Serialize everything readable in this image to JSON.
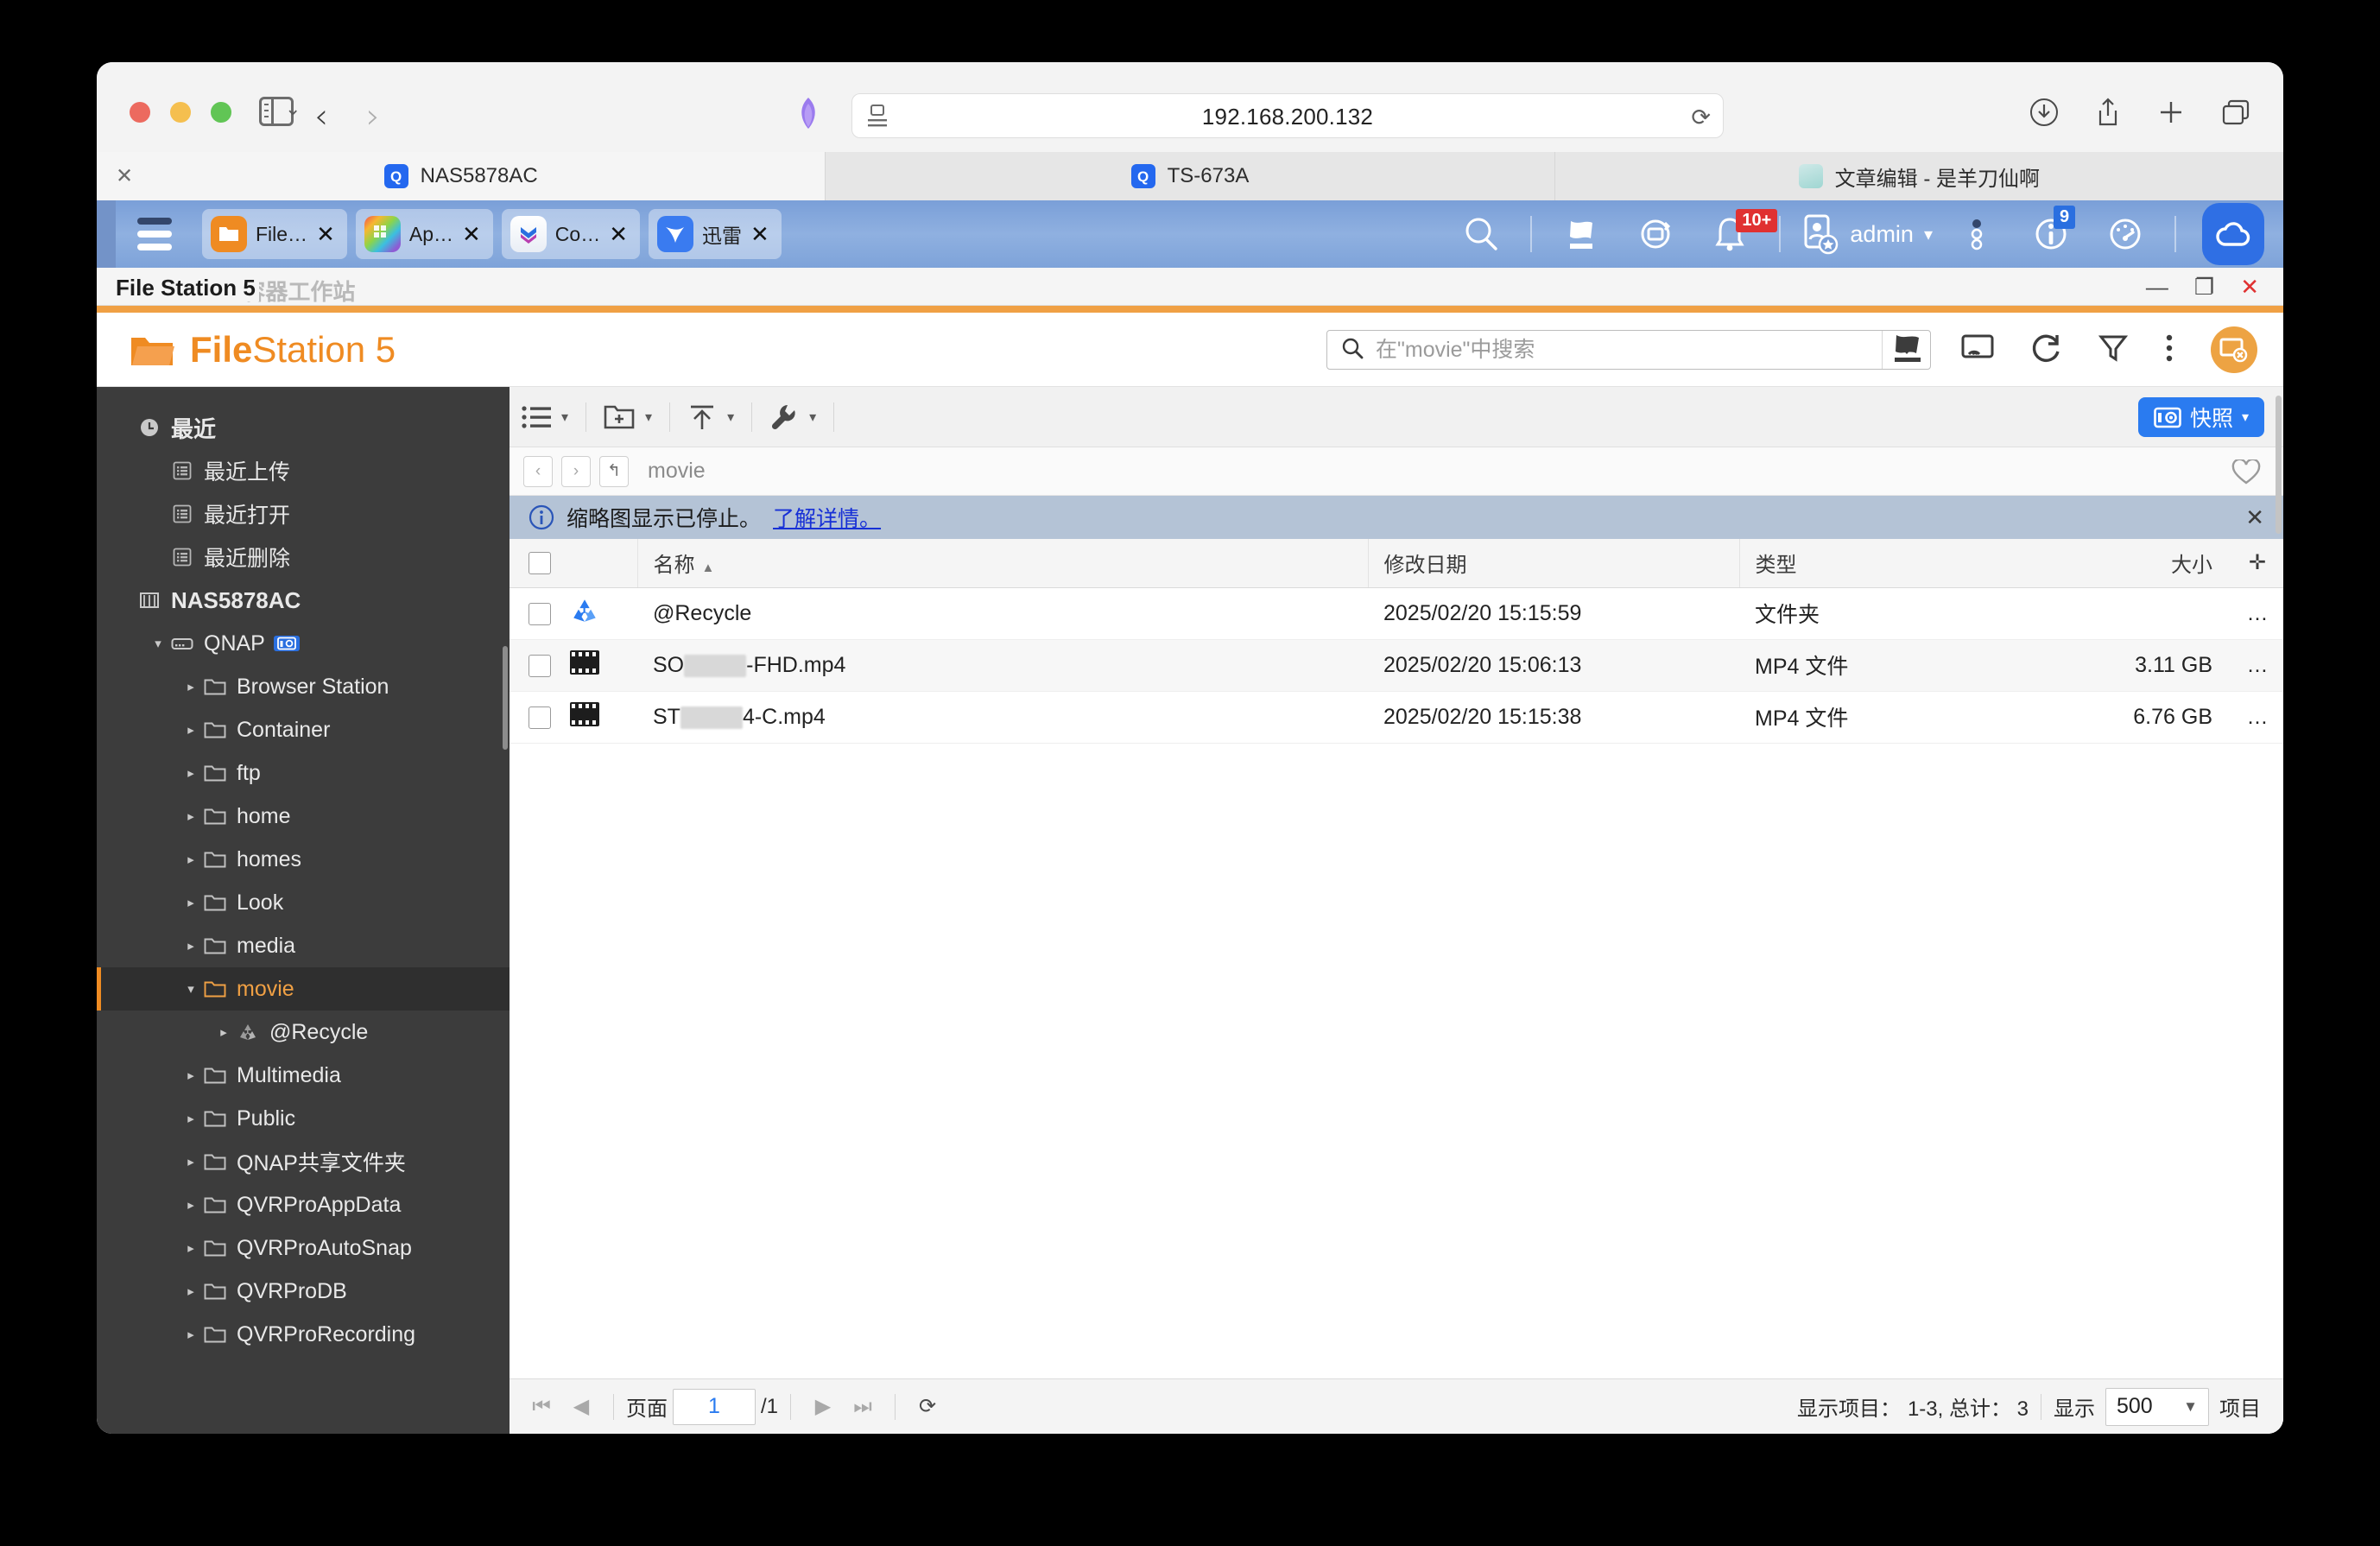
{
  "browser": {
    "url": "192.168.200.132",
    "tabs": [
      {
        "label": "NAS5878AC",
        "icon": "qnap-favicon",
        "active": true
      },
      {
        "label": "TS-673A",
        "icon": "qnap-favicon",
        "active": false
      },
      {
        "label": "文章编辑 - 是羊刀仙啊",
        "icon": "anime-favicon",
        "active": false
      }
    ],
    "toolbar": {
      "close_tab": "✕",
      "back": "‹",
      "forward": "›",
      "reload": "⟳"
    }
  },
  "taskbar": {
    "apps": [
      {
        "label": "File…",
        "icon": "filestation-icon",
        "close": "✕"
      },
      {
        "label": "Ap…",
        "icon": "appcenter-icon",
        "close": "✕"
      },
      {
        "label": "Co…",
        "icon": "container-icon",
        "close": "✕"
      },
      {
        "label": "迅雷",
        "icon": "xunlei-icon",
        "close": "✕"
      }
    ],
    "notification_badge": "10+",
    "info_badge": "9",
    "user": "admin",
    "user_caret": "▾"
  },
  "window": {
    "title": "File Station 5",
    "ghost_title": "File Station 容器工作站",
    "minimize": "—",
    "maximize": "❐",
    "close": "✕"
  },
  "app": {
    "brand_bold": "File",
    "brand_light": "Station 5",
    "search_placeholder": "在\"movie\"中搜索",
    "search_value": ""
  },
  "sidebar": {
    "items": [
      {
        "label": "最近",
        "depth": 0,
        "icon": "clock-icon",
        "bold": true,
        "arrow": ""
      },
      {
        "label": "最近上传",
        "depth": 1,
        "icon": "list-icon",
        "arrow": ""
      },
      {
        "label": "最近打开",
        "depth": 1,
        "icon": "list-icon",
        "arrow": ""
      },
      {
        "label": "最近删除",
        "depth": 1,
        "icon": "list-icon",
        "arrow": ""
      },
      {
        "label": "NAS5878AC",
        "depth": 0,
        "icon": "nas-icon",
        "bold": true,
        "arrow": ""
      },
      {
        "label": "QNAP",
        "depth": 1,
        "icon": "volume-icon",
        "arrow": "▾",
        "badge": "snapshot-badge"
      },
      {
        "label": "Browser Station",
        "depth": 2,
        "icon": "folder-icon",
        "arrow": "▸"
      },
      {
        "label": "Container",
        "depth": 2,
        "icon": "folder-icon",
        "arrow": "▸"
      },
      {
        "label": "ftp",
        "depth": 2,
        "icon": "folder-icon",
        "arrow": "▸"
      },
      {
        "label": "home",
        "depth": 2,
        "icon": "folder-icon",
        "arrow": "▸"
      },
      {
        "label": "homes",
        "depth": 2,
        "icon": "folder-icon",
        "arrow": "▸"
      },
      {
        "label": "Look",
        "depth": 2,
        "icon": "folder-icon",
        "arrow": "▸"
      },
      {
        "label": "media",
        "depth": 2,
        "icon": "folder-icon",
        "arrow": "▸"
      },
      {
        "label": "movie",
        "depth": 2,
        "icon": "folder-icon",
        "arrow": "▾",
        "selected": true
      },
      {
        "label": "@Recycle",
        "depth": 3,
        "icon": "recycle-icon",
        "arrow": "▸"
      },
      {
        "label": "Multimedia",
        "depth": 2,
        "icon": "folder-icon",
        "arrow": "▸"
      },
      {
        "label": "Public",
        "depth": 2,
        "icon": "folder-icon",
        "arrow": "▸"
      },
      {
        "label": "QNAP共享文件夹",
        "depth": 2,
        "icon": "folder-icon",
        "arrow": "▸"
      },
      {
        "label": "QVRProAppData",
        "depth": 2,
        "icon": "folder-icon",
        "arrow": "▸"
      },
      {
        "label": "QVRProAutoSnap",
        "depth": 2,
        "icon": "folder-icon",
        "arrow": "▸"
      },
      {
        "label": "QVRProDB",
        "depth": 2,
        "icon": "folder-icon",
        "arrow": "▸"
      },
      {
        "label": "QVRProRecording",
        "depth": 2,
        "icon": "folder-icon",
        "arrow": "▸"
      }
    ]
  },
  "toolbar": {
    "snapshot_label": "快照",
    "snapshot_caret": "▾",
    "caret": "▾"
  },
  "breadcrumb": {
    "back": "‹",
    "forward": "›",
    "up": "↰",
    "path": "movie"
  },
  "notice": {
    "message": "缩略图显示已停止。",
    "link": "了解详情。",
    "close": "✕"
  },
  "table": {
    "columns": {
      "name": "名称",
      "date": "修改日期",
      "type": "类型",
      "size": "大小",
      "add": "✛"
    },
    "sort_caret": "▲",
    "rows": [
      {
        "name": "@Recycle",
        "icon": "recycle-icon",
        "date": "2025/02/20 15:15:59",
        "type": "文件夹",
        "size": "",
        "more": "…"
      },
      {
        "name_prefix": "SO",
        "name_suffix": "-FHD.mp4",
        "redacted": true,
        "icon": "video-icon",
        "date": "2025/02/20 15:06:13",
        "type": "MP4 文件",
        "size": "3.11 GB",
        "more": "…"
      },
      {
        "name_prefix": "ST",
        "name_suffix": "4-C.mp4",
        "redacted": true,
        "icon": "video-icon",
        "date": "2025/02/20 15:15:38",
        "type": "MP4 文件",
        "size": "6.76 GB",
        "more": "…"
      }
    ]
  },
  "status": {
    "first": "⏮",
    "prev": "◀",
    "page_label": "页面",
    "page_value": "1",
    "page_total": "/1",
    "next": "▶",
    "last": "⏭",
    "refresh": "⟳",
    "items_label": "显示项目：",
    "items_range": "1-3, 总计： 3",
    "show_label": "显示",
    "page_size": "500",
    "page_size_caret": "▼",
    "items_suffix": "项目"
  },
  "colors": {
    "accent_orange": "#ef8b22",
    "taskbar_blue": "#7a9fd8",
    "snapshot_blue": "#2a7bf0",
    "notice_bg": "#b4c3d6",
    "sidebar_bg": "#3c3c3c"
  }
}
